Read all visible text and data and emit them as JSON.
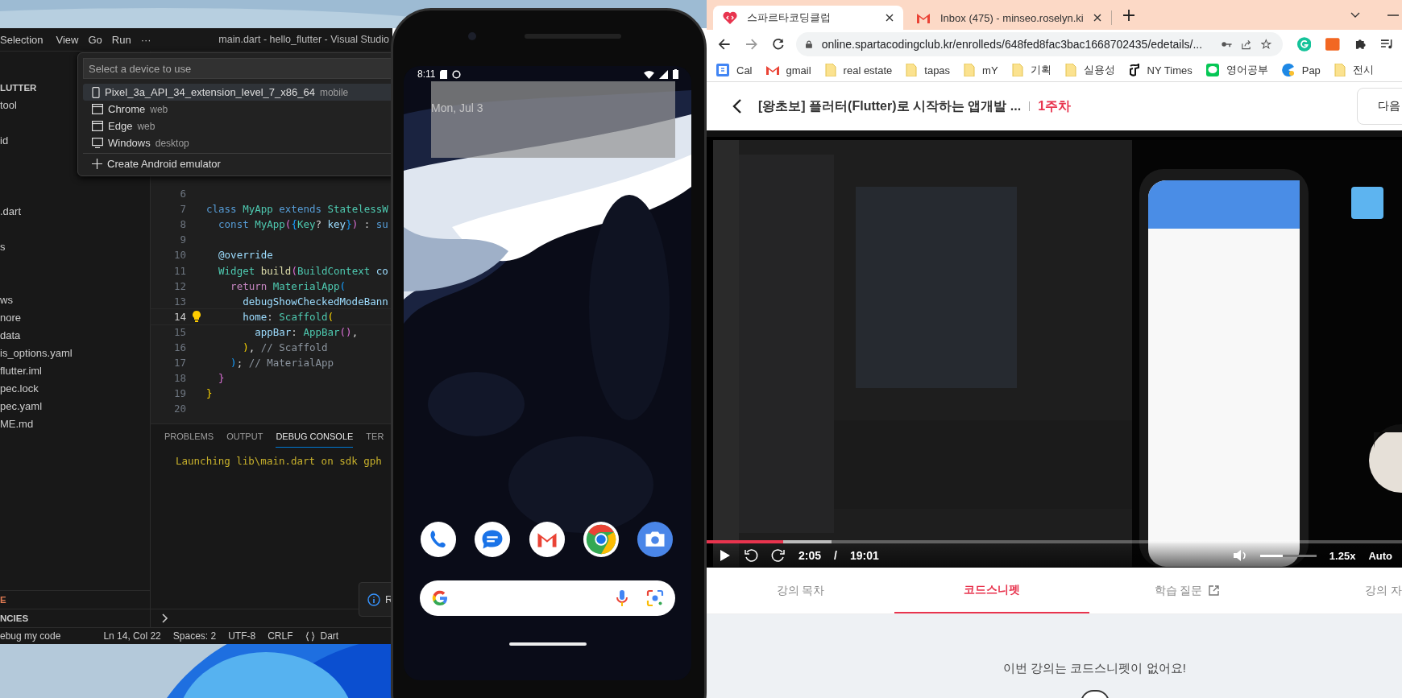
{
  "vscode": {
    "menu": [
      "Selection",
      "View",
      "Go",
      "Run",
      "···"
    ],
    "title": "main.dart - hello_flutter - Visual Studio",
    "quick_pick": {
      "placeholder": "Select a device to use",
      "items": [
        {
          "kind": "phone",
          "label": "Pixel_3a_API_34_extension_level_7_x86_64",
          "detail": "mobile",
          "selected": true
        },
        {
          "kind": "browser",
          "label": "Chrome",
          "detail": "web",
          "selected": false
        },
        {
          "kind": "browser",
          "label": "Edge",
          "detail": "web",
          "selected": false
        },
        {
          "kind": "desktop",
          "label": "Windows",
          "detail": "desktop",
          "selected": false
        },
        {
          "kind": "add",
          "label": "Create Android emulator",
          "selected": false
        }
      ]
    },
    "sidebar": {
      "items": [
        {
          "label": "LUTTER",
          "kind": "header"
        },
        {
          "label": "tool",
          "kind": "file"
        },
        {
          "label": "id",
          "kind": "file"
        },
        {
          "label": ".dart",
          "kind": "file"
        },
        {
          "label": "s",
          "kind": "file"
        },
        {
          "label": "ws",
          "kind": "file"
        },
        {
          "label": "nore",
          "kind": "file"
        },
        {
          "label": "data",
          "kind": "file"
        },
        {
          "label": "is_options.yaml",
          "kind": "file"
        },
        {
          "label": "flutter.iml",
          "kind": "file"
        },
        {
          "label": "pec.lock",
          "kind": "file"
        },
        {
          "label": "pec.yaml",
          "kind": "file"
        },
        {
          "label": "ME.md",
          "kind": "file"
        }
      ],
      "sections": [
        "E",
        "NCIES"
      ]
    },
    "editor": {
      "lines": [
        {
          "number": "6",
          "current": false,
          "lightbulb": false
        },
        {
          "number": "7",
          "current": false,
          "lightbulb": false,
          "tokens": [
            {
              "kind": "kw",
              "text": "class "
            },
            {
              "kind": "type",
              "text": "MyApp "
            },
            {
              "kind": "kw",
              "text": "extends "
            },
            {
              "kind": "type",
              "text": "StatelessW"
            }
          ]
        },
        {
          "number": "8",
          "current": false,
          "lightbulb": false,
          "tokens": [
            {
              "kind": "kw",
              "text": "  const "
            },
            {
              "kind": "type",
              "text": "MyApp"
            },
            {
              "kind": "b2",
              "text": "("
            },
            {
              "kind": "b3",
              "text": "{"
            },
            {
              "kind": "type",
              "text": "Key"
            },
            {
              "kind": "p",
              "text": "? "
            },
            {
              "kind": "var",
              "text": "key"
            },
            {
              "kind": "b3",
              "text": "}"
            },
            {
              "kind": "b2",
              "text": ")"
            },
            {
              "kind": "p",
              "text": " : "
            },
            {
              "kind": "kw",
              "text": "su"
            }
          ]
        },
        {
          "number": "9",
          "current": false,
          "lightbulb": false
        },
        {
          "number": "10",
          "current": false,
          "lightbulb": false,
          "tokens": [
            {
              "kind": "var",
              "text": "  @override"
            }
          ]
        },
        {
          "number": "11",
          "current": false,
          "lightbulb": false,
          "tokens": [
            {
              "kind": "type",
              "text": "  Widget "
            },
            {
              "kind": "fn",
              "text": "build"
            },
            {
              "kind": "b2",
              "text": "("
            },
            {
              "kind": "type",
              "text": "BuildContext "
            },
            {
              "kind": "var",
              "text": "co"
            }
          ]
        },
        {
          "number": "12",
          "current": false,
          "lightbulb": false,
          "tokens": [
            {
              "kind": "ctl",
              "text": "    return "
            },
            {
              "kind": "type",
              "text": "MaterialApp"
            },
            {
              "kind": "b3",
              "text": "("
            }
          ]
        },
        {
          "number": "13",
          "current": false,
          "lightbulb": false,
          "tokens": [
            {
              "kind": "var",
              "text": "      debugShowCheckedModeBann"
            }
          ]
        },
        {
          "number": "14",
          "current": true,
          "lightbulb": true,
          "tokens": [
            {
              "kind": "var",
              "text": "      home"
            },
            {
              "kind": "p",
              "text": ": "
            },
            {
              "kind": "type",
              "text": "Scaffold"
            },
            {
              "kind": "b1",
              "text": "("
            }
          ]
        },
        {
          "number": "15",
          "current": false,
          "lightbulb": false,
          "tokens": [
            {
              "kind": "var",
              "text": "        appBar"
            },
            {
              "kind": "p",
              "text": ": "
            },
            {
              "kind": "type",
              "text": "AppBar"
            },
            {
              "kind": "b2",
              "text": "()"
            },
            {
              "kind": "p",
              "text": ","
            }
          ]
        },
        {
          "number": "16",
          "current": false,
          "lightbulb": false,
          "tokens": [
            {
              "kind": "b1",
              "text": "      )"
            },
            {
              "kind": "p",
              "text": ", "
            },
            {
              "kind": "cm",
              "text": "// Scaffold"
            }
          ]
        },
        {
          "number": "17",
          "current": false,
          "lightbulb": false,
          "tokens": [
            {
              "kind": "b3",
              "text": "    )"
            },
            {
              "kind": "p",
              "text": "; "
            },
            {
              "kind": "cm",
              "text": "// MaterialApp"
            }
          ]
        },
        {
          "number": "18",
          "current": false,
          "lightbulb": false,
          "tokens": [
            {
              "kind": "b2",
              "text": "  }"
            }
          ]
        },
        {
          "number": "19",
          "current": false,
          "lightbulb": false,
          "tokens": [
            {
              "kind": "b1",
              "text": "}"
            }
          ]
        },
        {
          "number": "20",
          "current": false,
          "lightbulb": false
        }
      ]
    },
    "panel": {
      "tabs": [
        {
          "label": "PROBLEMS",
          "selected": false
        },
        {
          "label": "OUTPUT",
          "selected": false
        },
        {
          "label": "DEBUG CONSOLE",
          "selected": true
        },
        {
          "label": "TER",
          "selected": false
        }
      ],
      "output": [
        "Launching lib\\main.dart on sdk gph"
      ]
    },
    "notification": {
      "text": "R"
    },
    "status_bar": {
      "left": "ebug my code",
      "items": [
        "Ln 14, Col 22",
        "Spaces: 2",
        "UTF-8",
        "CRLF"
      ],
      "language": "Dart"
    }
  },
  "emulator": {
    "time": "8:11",
    "widget_date": "Mon, Jul 3"
  },
  "browser": {
    "tabs": [
      {
        "title": "스파르타코딩클럽",
        "kind": "sparta",
        "selected": true
      },
      {
        "title": "Inbox (475) - minseo.roselyn.ki",
        "kind": "gmail",
        "selected": false
      }
    ],
    "address": "online.spartacodingclub.kr/enrolleds/648fed8fac3bac1668702435/edetails/...",
    "bookmarks": [
      {
        "label": "Cal",
        "kind": "calendar"
      },
      {
        "label": "gmail",
        "kind": "gmail"
      },
      {
        "label": "real estate",
        "kind": "folder"
      },
      {
        "label": "tapas",
        "kind": "folder"
      },
      {
        "label": "mY",
        "kind": "folder"
      },
      {
        "label": "기획",
        "kind": "folder"
      },
      {
        "label": "실용성",
        "kind": "folder"
      },
      {
        "label": "NY Times",
        "kind": "nyt"
      },
      {
        "label": "영어공부",
        "kind": "chat"
      },
      {
        "label": "Pap",
        "kind": "pap"
      },
      {
        "label": "전시",
        "kind": "folder"
      }
    ],
    "page": {
      "title": "[왕초보] 플러터(Flutter)로 시작하는 앱개발 ...",
      "week": "1주차",
      "next_button": "다음",
      "video": {
        "elapsed": "2:05",
        "separator": "/",
        "duration": "19:01",
        "speed": "1.25x",
        "quality": "Auto",
        "progress": {
          "level": 0.11
        },
        "buffered": {
          "level": 0.18
        },
        "volume": {
          "level": 0.4
        }
      },
      "tabs": [
        {
          "label": "강의 목차",
          "selected": false,
          "external": false
        },
        {
          "label": "코드스니펫",
          "selected": true,
          "external": false
        },
        {
          "label": "학습 질문",
          "selected": false,
          "external": true
        },
        {
          "label": "강의 자",
          "selected": false,
          "external": false
        }
      ],
      "empty_message": "이번 강의는 코드스니펫이 없어요!"
    }
  }
}
